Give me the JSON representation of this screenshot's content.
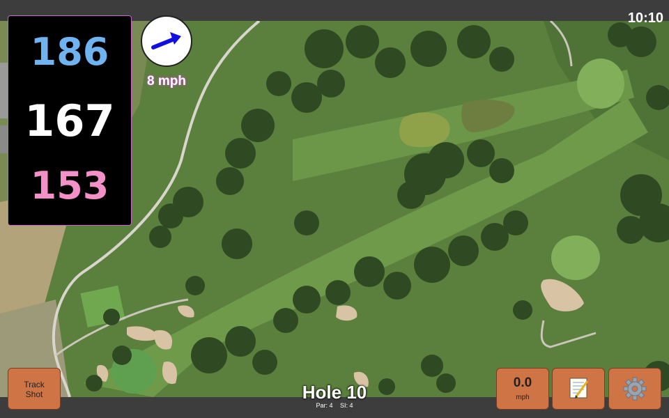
{
  "clock": "10:10",
  "distances": {
    "back": "186",
    "middle": "167",
    "front": "153"
  },
  "wind": {
    "speed": "8 mph",
    "direction_icon": "arrow-right-up-icon"
  },
  "hole": {
    "title": "Hole 10",
    "par": "Par: 4",
    "stroke_index": "SI: 4"
  },
  "buttons": {
    "track_shot_line1": "Track",
    "track_shot_line2": "Shot",
    "speed_value": "0.0",
    "speed_unit": "mph",
    "notes_icon": "notepad-icon",
    "settings_icon": "gear-icon"
  },
  "colors": {
    "back": "#6fb3f0",
    "middle": "#ffffff",
    "front": "#f490c8",
    "button": "#cf7445",
    "panel_border": "#cc66cc"
  }
}
